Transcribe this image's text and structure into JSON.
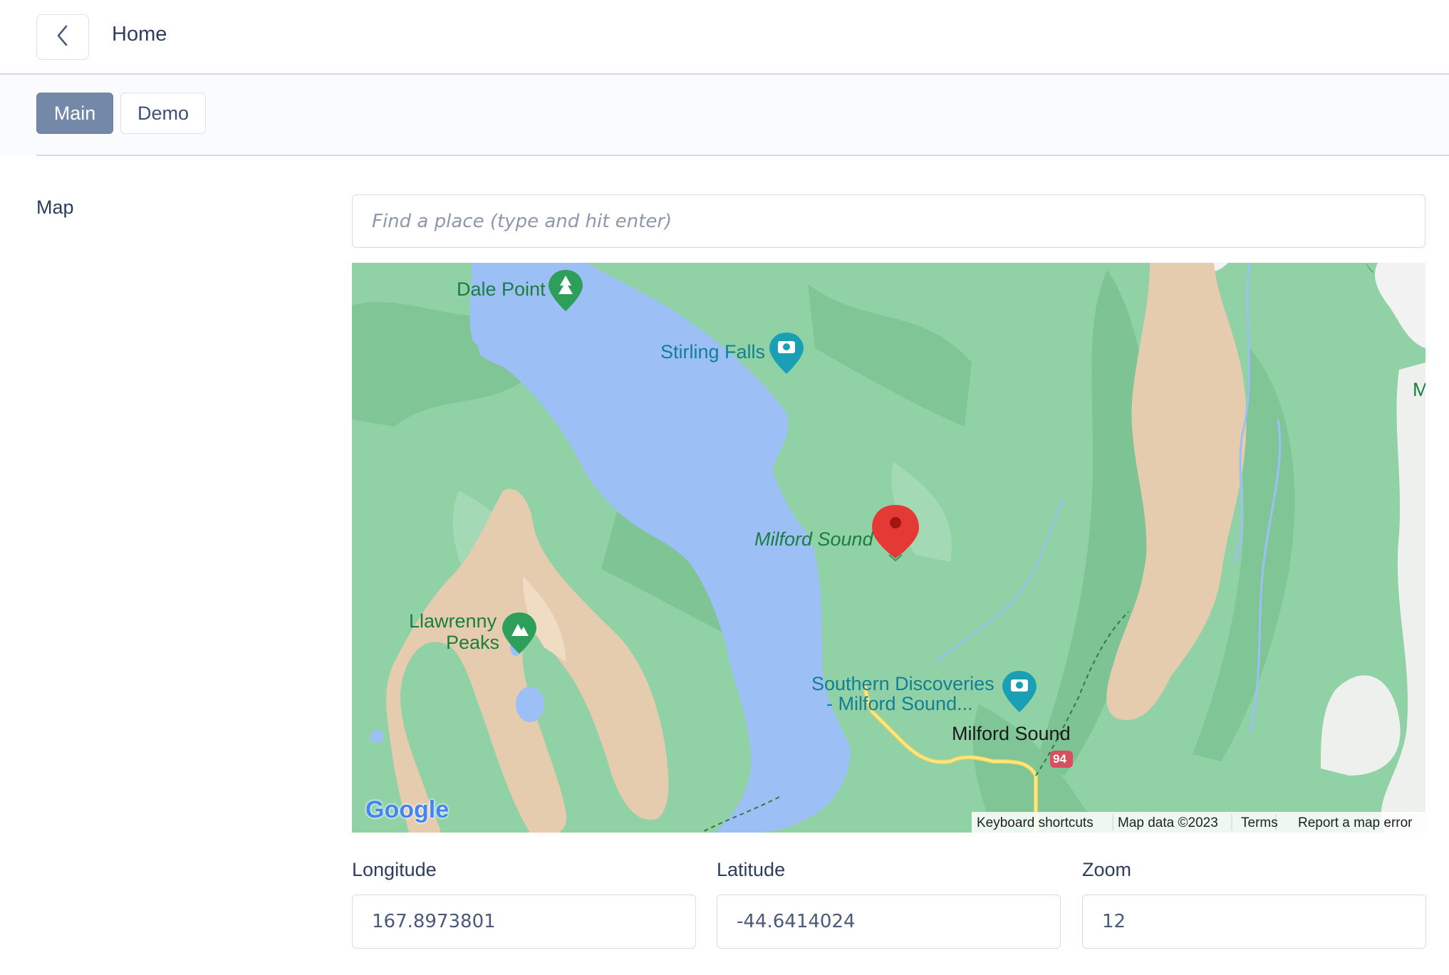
{
  "header": {
    "title": "Home"
  },
  "tabs": [
    {
      "label": "Main",
      "active": true
    },
    {
      "label": "Demo",
      "active": false
    }
  ],
  "map_field": {
    "label": "Map",
    "search_placeholder": "Find a place (type and hit enter)",
    "map": {
      "places": {
        "dale_point": "Dale Point",
        "stirling_falls": "Stirling Falls",
        "milford_sound_marker": "Milford Sound",
        "llawrenny_line1": "Llawrenny",
        "llawrenny_line2": "Peaks",
        "southern_line1": "Southern Discoveries",
        "southern_line2": "- Milford Sound...",
        "milford_sound_town": "Milford Sound",
        "edge_label": "M"
      },
      "road_shield": "94",
      "logo": "Google",
      "attribution": {
        "keyboard_shortcuts": "Keyboard shortcuts",
        "map_data": "Map data ©2023",
        "terms": "Terms",
        "report": "Report a map error"
      },
      "colors": {
        "water": "#9cbff5",
        "forest": "#8fd0a5",
        "terrain": "#e6cdb0",
        "marker": "#e53935",
        "poi_green": "#2e9e5b",
        "poi_teal": "#1a9fb5"
      }
    }
  },
  "coordinates": {
    "longitude": {
      "label": "Longitude",
      "value": "167.8973801"
    },
    "latitude": {
      "label": "Latitude",
      "value": "-44.6414024"
    },
    "zoom": {
      "label": "Zoom",
      "value": "12"
    }
  }
}
